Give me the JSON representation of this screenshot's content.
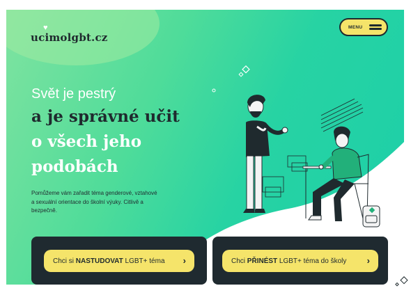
{
  "logo": {
    "text": "ucimolgbt.cz",
    "heart": "♥"
  },
  "menu": {
    "label": "MENU"
  },
  "hero": {
    "line1": "Svět je pestrý",
    "line2": "a je správné učit",
    "line3": "o všech jeho",
    "line4": "podobách",
    "description": "Pomůžeme vám zařadit téma genderové, vztahové a sexuální orientace do školní výuky. Citlivě a bezpečně."
  },
  "cta": [
    {
      "pre": "Chci si ",
      "bold": "NASTUDOVAT",
      "post": " LGBT+ téma",
      "chevron": "›"
    },
    {
      "pre": "Chci ",
      "bold": "PŘINÉST",
      "post": " LGBT+ téma do školy",
      "chevron": "›"
    }
  ],
  "colors": {
    "accent_yellow": "#f5e46a",
    "dark": "#1f2a30",
    "green": "#27d3a3"
  }
}
